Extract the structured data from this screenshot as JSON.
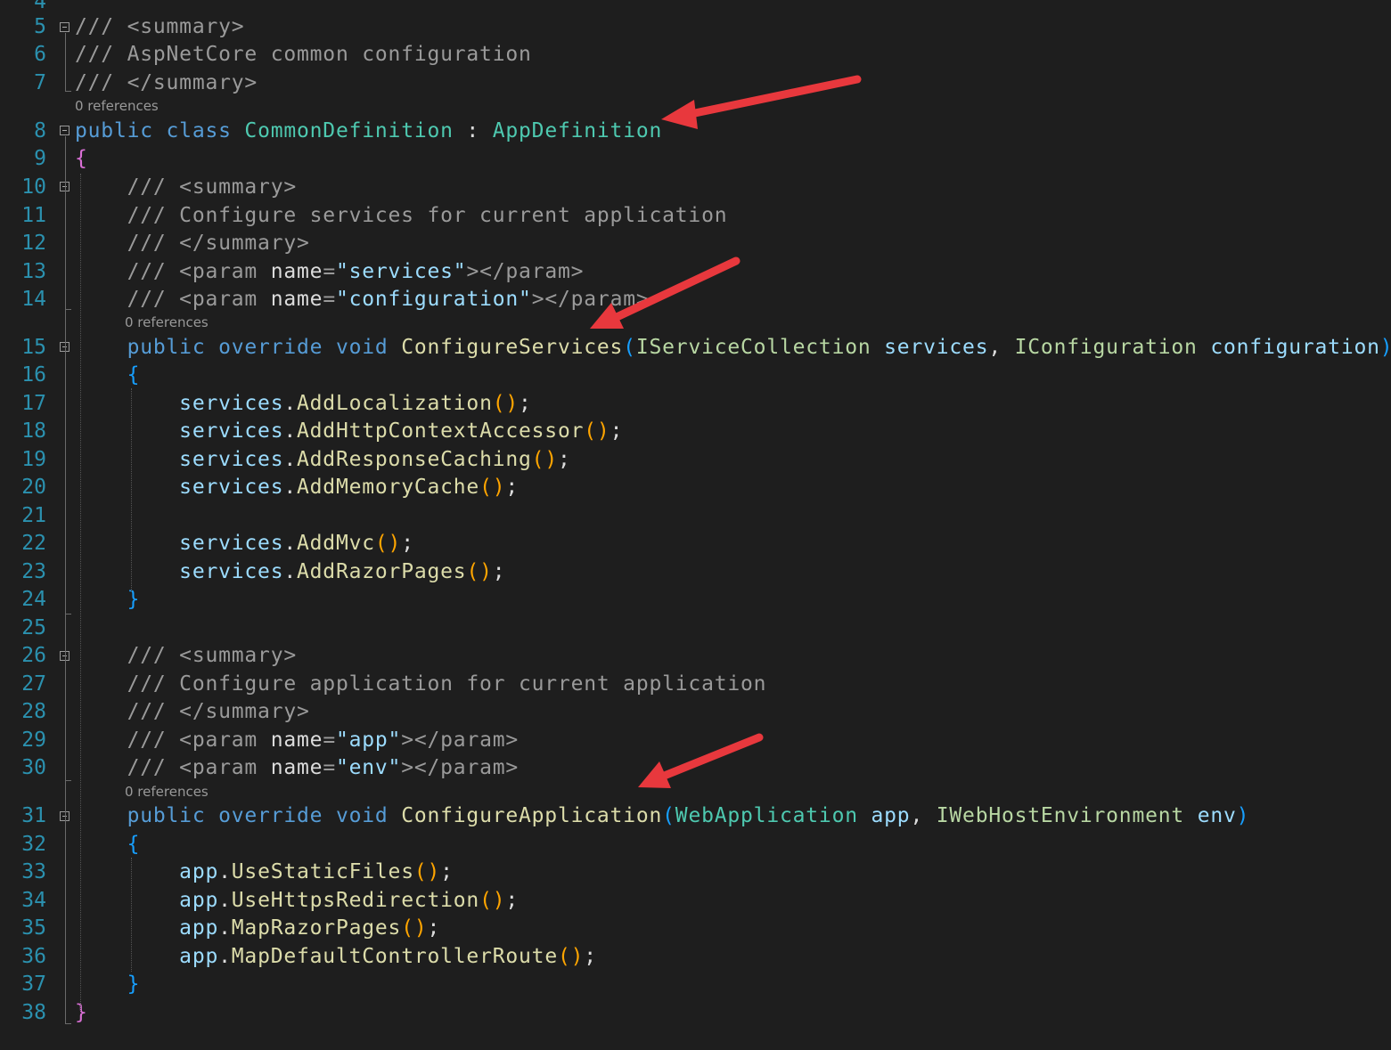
{
  "editor": {
    "references_label": "0 references",
    "lines": [
      {
        "num": "4",
        "tokens": []
      },
      {
        "num": "5",
        "tokens": [
          {
            "t": "/// <summary>",
            "c": "comment"
          }
        ]
      },
      {
        "num": "6",
        "tokens": [
          {
            "t": "/// AspNetCore common configuration",
            "c": "comment"
          }
        ]
      },
      {
        "num": "7",
        "tokens": [
          {
            "t": "/// </summary>",
            "c": "comment"
          }
        ]
      },
      {
        "num": "8",
        "tokens": [
          {
            "t": "public class ",
            "c": "keyword"
          },
          {
            "t": "CommonDefinition",
            "c": "type"
          },
          {
            "t": " : ",
            "c": "plain"
          },
          {
            "t": "AppDefinition",
            "c": "type"
          }
        ]
      },
      {
        "num": "9",
        "tokens": [
          {
            "t": "{",
            "c": "brace1"
          }
        ]
      },
      {
        "num": "10",
        "tokens": [
          {
            "t": "    /// <summary>",
            "c": "comment"
          }
        ]
      },
      {
        "num": "11",
        "tokens": [
          {
            "t": "    /// Configure services for current application",
            "c": "comment"
          }
        ]
      },
      {
        "num": "12",
        "tokens": [
          {
            "t": "    /// </summary>",
            "c": "comment"
          }
        ]
      },
      {
        "num": "13",
        "tokens": [
          {
            "t": "    /// <param ",
            "c": "comment"
          },
          {
            "t": "name",
            "c": "xmlname"
          },
          {
            "t": "=",
            "c": "comment"
          },
          {
            "t": "\"services\"",
            "c": "xmlvalue"
          },
          {
            "t": "></param>",
            "c": "comment"
          }
        ]
      },
      {
        "num": "14",
        "tokens": [
          {
            "t": "    /// <param ",
            "c": "comment"
          },
          {
            "t": "name",
            "c": "xmlname"
          },
          {
            "t": "=",
            "c": "comment"
          },
          {
            "t": "\"configuration\"",
            "c": "xmlvalue"
          },
          {
            "t": "></param>",
            "c": "comment"
          }
        ]
      },
      {
        "num": "15",
        "tokens": [
          {
            "t": "    public override void ",
            "c": "keyword"
          },
          {
            "t": "ConfigureServices",
            "c": "method"
          },
          {
            "t": "(",
            "c": "brace2"
          },
          {
            "t": "IServiceCollection",
            "c": "iface"
          },
          {
            "t": " services",
            "c": "param"
          },
          {
            "t": ", ",
            "c": "plain"
          },
          {
            "t": "IConfiguration",
            "c": "iface"
          },
          {
            "t": " configuration",
            "c": "param"
          },
          {
            "t": ")",
            "c": "brace2"
          }
        ]
      },
      {
        "num": "16",
        "tokens": [
          {
            "t": "    {",
            "c": "brace2"
          }
        ]
      },
      {
        "num": "17",
        "tokens": [
          {
            "t": "        services",
            "c": "param"
          },
          {
            "t": ".",
            "c": "plain"
          },
          {
            "t": "AddLocalization",
            "c": "method"
          },
          {
            "t": "()",
            "c": "paren"
          },
          {
            "t": ";",
            "c": "plain"
          }
        ]
      },
      {
        "num": "18",
        "tokens": [
          {
            "t": "        services",
            "c": "param"
          },
          {
            "t": ".",
            "c": "plain"
          },
          {
            "t": "AddHttpContextAccessor",
            "c": "method"
          },
          {
            "t": "()",
            "c": "paren"
          },
          {
            "t": ";",
            "c": "plain"
          }
        ]
      },
      {
        "num": "19",
        "tokens": [
          {
            "t": "        services",
            "c": "param"
          },
          {
            "t": ".",
            "c": "plain"
          },
          {
            "t": "AddResponseCaching",
            "c": "method"
          },
          {
            "t": "()",
            "c": "paren"
          },
          {
            "t": ";",
            "c": "plain"
          }
        ]
      },
      {
        "num": "20",
        "tokens": [
          {
            "t": "        services",
            "c": "param"
          },
          {
            "t": ".",
            "c": "plain"
          },
          {
            "t": "AddMemoryCache",
            "c": "method"
          },
          {
            "t": "()",
            "c": "paren"
          },
          {
            "t": ";",
            "c": "plain"
          }
        ]
      },
      {
        "num": "21",
        "tokens": []
      },
      {
        "num": "22",
        "tokens": [
          {
            "t": "        services",
            "c": "param"
          },
          {
            "t": ".",
            "c": "plain"
          },
          {
            "t": "AddMvc",
            "c": "method"
          },
          {
            "t": "()",
            "c": "paren"
          },
          {
            "t": ";",
            "c": "plain"
          }
        ]
      },
      {
        "num": "23",
        "tokens": [
          {
            "t": "        services",
            "c": "param"
          },
          {
            "t": ".",
            "c": "plain"
          },
          {
            "t": "AddRazorPages",
            "c": "method"
          },
          {
            "t": "()",
            "c": "paren"
          },
          {
            "t": ";",
            "c": "plain"
          }
        ]
      },
      {
        "num": "24",
        "tokens": [
          {
            "t": "    }",
            "c": "brace2"
          }
        ]
      },
      {
        "num": "25",
        "tokens": []
      },
      {
        "num": "26",
        "tokens": [
          {
            "t": "    /// <summary>",
            "c": "comment"
          }
        ]
      },
      {
        "num": "27",
        "tokens": [
          {
            "t": "    /// Configure application for current application",
            "c": "comment"
          }
        ]
      },
      {
        "num": "28",
        "tokens": [
          {
            "t": "    /// </summary>",
            "c": "comment"
          }
        ]
      },
      {
        "num": "29",
        "tokens": [
          {
            "t": "    /// <param ",
            "c": "comment"
          },
          {
            "t": "name",
            "c": "xmlname"
          },
          {
            "t": "=",
            "c": "comment"
          },
          {
            "t": "\"app\"",
            "c": "xmlvalue"
          },
          {
            "t": "></param>",
            "c": "comment"
          }
        ]
      },
      {
        "num": "30",
        "tokens": [
          {
            "t": "    /// <param ",
            "c": "comment"
          },
          {
            "t": "name",
            "c": "xmlname"
          },
          {
            "t": "=",
            "c": "comment"
          },
          {
            "t": "\"env\"",
            "c": "xmlvalue"
          },
          {
            "t": "></param>",
            "c": "comment"
          }
        ]
      },
      {
        "num": "31",
        "tokens": [
          {
            "t": "    public override void ",
            "c": "keyword"
          },
          {
            "t": "ConfigureApplication",
            "c": "method"
          },
          {
            "t": "(",
            "c": "brace2"
          },
          {
            "t": "WebApplication",
            "c": "type"
          },
          {
            "t": " app",
            "c": "param"
          },
          {
            "t": ", ",
            "c": "plain"
          },
          {
            "t": "IWebHostEnvironment",
            "c": "iface"
          },
          {
            "t": " env",
            "c": "param"
          },
          {
            "t": ")",
            "c": "brace2"
          }
        ]
      },
      {
        "num": "32",
        "tokens": [
          {
            "t": "    {",
            "c": "brace2"
          }
        ]
      },
      {
        "num": "33",
        "tokens": [
          {
            "t": "        app",
            "c": "param"
          },
          {
            "t": ".",
            "c": "plain"
          },
          {
            "t": "UseStaticFiles",
            "c": "method"
          },
          {
            "t": "()",
            "c": "paren"
          },
          {
            "t": ";",
            "c": "plain"
          }
        ]
      },
      {
        "num": "34",
        "tokens": [
          {
            "t": "        app",
            "c": "param"
          },
          {
            "t": ".",
            "c": "plain"
          },
          {
            "t": "UseHttpsRedirection",
            "c": "method"
          },
          {
            "t": "()",
            "c": "paren"
          },
          {
            "t": ";",
            "c": "plain"
          }
        ]
      },
      {
        "num": "35",
        "tokens": [
          {
            "t": "        app",
            "c": "param"
          },
          {
            "t": ".",
            "c": "plain"
          },
          {
            "t": "MapRazorPages",
            "c": "method"
          },
          {
            "t": "()",
            "c": "paren"
          },
          {
            "t": ";",
            "c": "plain"
          }
        ]
      },
      {
        "num": "36",
        "tokens": [
          {
            "t": "        app",
            "c": "param"
          },
          {
            "t": ".",
            "c": "plain"
          },
          {
            "t": "MapDefaultControllerRoute",
            "c": "method"
          },
          {
            "t": "()",
            "c": "paren"
          },
          {
            "t": ";",
            "c": "plain"
          }
        ]
      },
      {
        "num": "37",
        "tokens": [
          {
            "t": "    }",
            "c": "brace2"
          }
        ]
      },
      {
        "num": "38",
        "tokens": [
          {
            "t": "}",
            "c": "brace1"
          }
        ]
      }
    ]
  },
  "annotation_color": "#e8383d"
}
